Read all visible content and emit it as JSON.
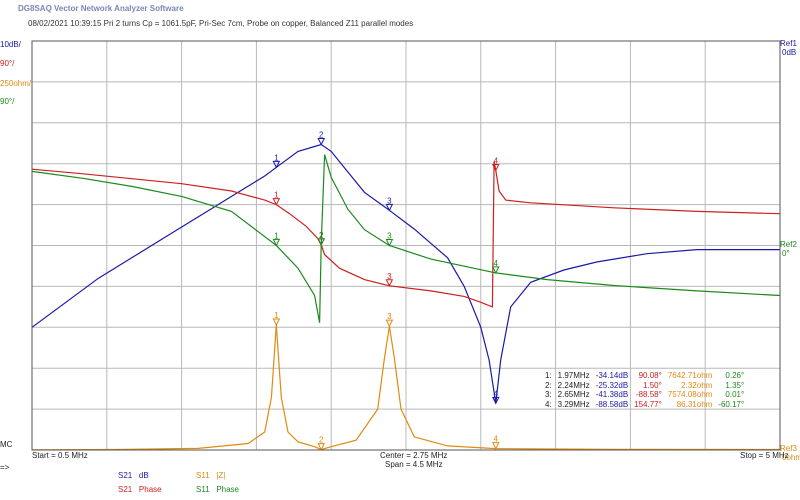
{
  "app_title": "DG8SAQ Vector Network Analyzer Software",
  "subtitle": "08/02/2021    10:39:15    Pri 2 turns Cp = 1061.5pF, Pri-Sec 7cm, Probe on copper, Balanced Z11 parallel modes",
  "left_scale_labels": [
    {
      "text": "10dB/",
      "color": "#1a1aa6"
    },
    {
      "text": "90°/",
      "color": "#cc2020"
    },
    {
      "text": "250ohm/",
      "color": "#e08a10"
    },
    {
      "text": "90°/",
      "color": "#1a8a1a"
    }
  ],
  "right_ref_top": [
    "Ref1",
    "0dB"
  ],
  "right_ref_mid": [
    "Ref2",
    "0°"
  ],
  "right_ref_bottom": [
    "Ref3",
    "0ohm"
  ],
  "left_mc": "MC",
  "left_arrow": "=>",
  "footer": {
    "start": "Start = 0.5 MHz",
    "center": "Center = 2.75 MHz",
    "span": "Span = 4.5 MHz",
    "stop": "Stop = 5 MHz"
  },
  "legend": [
    {
      "label_a": "S21",
      "label_b": "dB",
      "color": "#1a1aa6"
    },
    {
      "label_a": "S11",
      "label_b": "|Z|",
      "color": "#e08a10"
    },
    {
      "label_a": "S21",
      "label_b": "Phase",
      "color": "#cc2020"
    },
    {
      "label_a": "S11",
      "label_b": "Phase",
      "color": "#1a8a1a"
    }
  ],
  "marker_table": {
    "rows": [
      [
        "1:",
        "1.97MHz",
        "-34.14dB",
        "90.08°",
        "7642.71ohm",
        "0.26°"
      ],
      [
        "2:",
        "2.24MHz",
        "-25.32dB",
        "1.50°",
        "2.32ohm",
        "1.35°"
      ],
      [
        "3:",
        "2.65MHz",
        "-41.38dB",
        "-88.58°",
        "7574.08ohm",
        "0.01°"
      ],
      [
        "4:",
        "3.29MHz",
        "-88.58dB",
        "154.77°",
        "86.31ohm",
        "-60.17°"
      ]
    ],
    "colors": [
      "#222222",
      "#222222",
      "#1a1aa6",
      "#cc2020",
      "#e08a10",
      "#1a8a1a"
    ]
  },
  "chart_data": {
    "type": "line",
    "title": "",
    "xlabel": "",
    "x_unit": "MHz",
    "xlim": [
      0.5,
      5.0
    ],
    "grid": true,
    "series": [
      {
        "name": "S21 dB",
        "color": "#1a1aa6",
        "axis": "dB",
        "ylim": [
          -100,
          0
        ],
        "x": [
          0.5,
          0.7,
          0.9,
          1.1,
          1.3,
          1.5,
          1.7,
          1.9,
          2.0,
          2.1,
          2.2,
          2.24,
          2.3,
          2.4,
          2.5,
          2.65,
          2.8,
          3.0,
          3.1,
          3.2,
          3.25,
          3.29,
          3.32,
          3.38,
          3.5,
          3.7,
          3.9,
          4.2,
          4.5,
          5.0
        ],
        "y": [
          -70,
          -64,
          -58,
          -53,
          -48,
          -43,
          -38,
          -33,
          -30,
          -27,
          -25.8,
          -25.3,
          -27,
          -32,
          -37,
          -41.4,
          -46,
          -53,
          -60,
          -70,
          -78,
          -88.6,
          -78,
          -65,
          -59,
          -56,
          -54,
          -52,
          -51,
          -51
        ]
      },
      {
        "name": "S21 Phase",
        "color": "#cc2020",
        "axis": "deg",
        "ylim": [
          -450,
          450
        ],
        "x": [
          0.5,
          0.8,
          1.1,
          1.4,
          1.7,
          1.9,
          1.97,
          2.05,
          2.15,
          2.22,
          2.24,
          2.26,
          2.35,
          2.5,
          2.65,
          2.9,
          3.1,
          3.2,
          3.27,
          3.28,
          3.29,
          3.31,
          3.35,
          3.5,
          4.0,
          4.5,
          5.0
        ],
        "y": [
          168,
          158,
          147,
          136,
          120,
          100,
          90,
          70,
          42,
          15,
          1.5,
          -20,
          -50,
          -75,
          -88.6,
          -100,
          -112,
          -125,
          -135,
          185,
          165,
          120,
          100,
          94,
          83,
          75,
          70
        ]
      },
      {
        "name": "S11 |Z|",
        "color": "#e08a10",
        "axis": "ohm",
        "ylim": [
          0,
          2500
        ],
        "x": [
          0.5,
          1.0,
          1.5,
          1.8,
          1.9,
          1.94,
          1.97,
          2.0,
          2.04,
          2.1,
          2.2,
          2.24,
          2.3,
          2.45,
          2.58,
          2.62,
          2.65,
          2.68,
          2.72,
          2.8,
          3.0,
          3.29,
          3.6,
          4.0,
          5.0
        ],
        "y": [
          1,
          3,
          10,
          40,
          110,
          320,
          764,
          320,
          110,
          50,
          20,
          2.3,
          20,
          60,
          250,
          560,
          757,
          560,
          250,
          80,
          25,
          8.6,
          6,
          4,
          3
        ]
      },
      {
        "name": "S11 Phase",
        "color": "#1a8a1a",
        "axis": "deg",
        "ylim": [
          -450,
          450
        ],
        "x": [
          0.5,
          0.8,
          1.1,
          1.4,
          1.7,
          1.97,
          2.1,
          2.2,
          2.23,
          2.24,
          2.26,
          2.3,
          2.4,
          2.5,
          2.65,
          2.9,
          3.29,
          3.6,
          4.0,
          4.5,
          5.0
        ],
        "y": [
          163,
          148,
          130,
          108,
          75,
          0.26,
          -50,
          -110,
          -170,
          1.35,
          200,
          150,
          80,
          35,
          0.01,
          -30,
          -60.2,
          -75,
          -88,
          -100,
          -110
        ]
      }
    ],
    "markers": [
      {
        "id": "1",
        "x": 1.97
      },
      {
        "id": "2",
        "x": 2.24
      },
      {
        "id": "3",
        "x": 2.65
      },
      {
        "id": "4",
        "x": 3.29
      }
    ]
  }
}
